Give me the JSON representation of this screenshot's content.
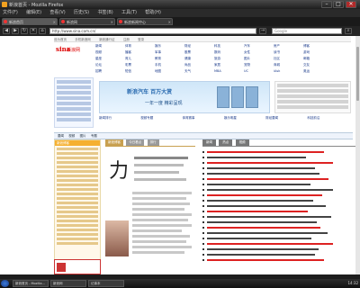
{
  "window": {
    "title": "新浪首页 - Mozilla Firefox",
    "buttons": {
      "minimize": "–",
      "maximize": "□",
      "close": "✕"
    }
  },
  "menu": [
    "文件(F)",
    "编辑(E)",
    "查看(V)",
    "历史(S)",
    "书签(B)",
    "工具(T)",
    "帮助(H)"
  ],
  "tabs": [
    {
      "label": "新浪首页"
    },
    {
      "label": "新浪网"
    },
    {
      "label": "新浪新闻中心"
    }
  ],
  "nav": {
    "url": "http://www.sina.com.cn/",
    "search_placeholder": "Google"
  },
  "page": {
    "logo_mark": "sina",
    "logo_text": "新浪网",
    "top_links": [
      "设为首页",
      "手机新浪网",
      "新浪通行证",
      "注册",
      "登录"
    ],
    "nav_links": [
      "新闻",
      "体育",
      "娱乐",
      "财经",
      "科技",
      "汽车",
      "房产",
      "博客",
      "视频",
      "播客",
      "军事",
      "股票",
      "数码",
      "女性",
      "读书",
      "游戏",
      "星座",
      "育儿",
      "教育",
      "健康",
      "旅游",
      "图片",
      "社区",
      "邮箱",
      "论坛",
      "彩票",
      "手机",
      "尚品",
      "家居",
      "宠物",
      "商城",
      "交友",
      "招聘",
      "短信",
      "地图",
      "天气",
      "MBA",
      "UC",
      "iAsk",
      "奥运"
    ],
    "banner_line1": "新浪汽车 百万大赏",
    "banner_line2": "一年一度 精彩呈现",
    "link_row": [
      "新闻排行",
      "视频专题",
      "体育赛事",
      "娱乐明星",
      "财经要闻",
      "科技前沿"
    ],
    "section_tabs": [
      "要闻",
      "视频",
      "图片",
      "专题"
    ],
    "left_head": "新浪博客",
    "mid_tabs": [
      "新浪博客",
      "今日看点",
      "排行"
    ],
    "mid_big_char": "力",
    "right_tabs": [
      "新闻",
      "热点",
      "视频"
    ]
  },
  "taskbar": {
    "items": [
      "新浪首页 - Mozilla...",
      "新浪网",
      "记事本"
    ],
    "clock": "14:32"
  }
}
